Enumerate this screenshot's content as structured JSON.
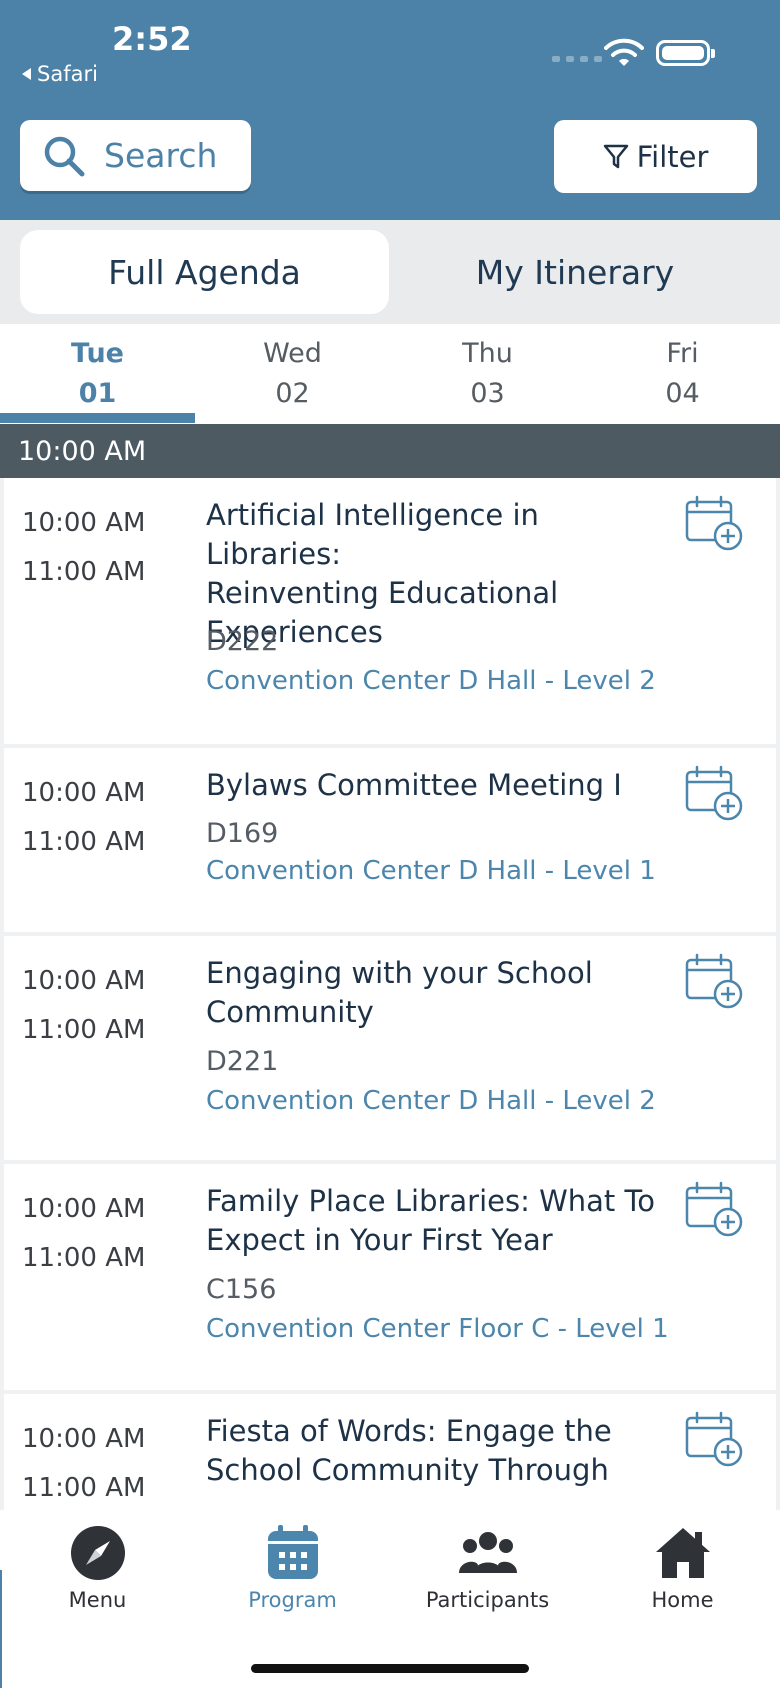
{
  "status_bar": {
    "time": "2:52",
    "back_app": "Safari"
  },
  "header": {
    "search_label": "Search",
    "filter_label": "Filter"
  },
  "segments": {
    "active": "Full Agenda",
    "other": "My Itinerary"
  },
  "days": [
    {
      "name": "Tue",
      "num": "01",
      "active": true
    },
    {
      "name": "Wed",
      "num": "02",
      "active": false
    },
    {
      "name": "Thu",
      "num": "03",
      "active": false
    },
    {
      "name": "Fri",
      "num": "04",
      "active": false
    }
  ],
  "time_group": "10:00 AM",
  "sessions": [
    {
      "start": "10:00 AM",
      "end": "11:00 AM",
      "title_lines": [
        "Artificial Intelligence in Libraries:",
        "Reinventing Educational",
        "Experiences"
      ],
      "room": "D222",
      "venue": "Convention Center D Hall - Level 2"
    },
    {
      "start": "10:00 AM",
      "end": "11:00 AM",
      "title_lines": [
        "Bylaws Committee Meeting I"
      ],
      "room": "D169",
      "venue": "Convention Center D Hall - Level 1"
    },
    {
      "start": "10:00 AM",
      "end": "11:00 AM",
      "title_lines": [
        "Engaging with your School",
        "Community"
      ],
      "room": "D221",
      "venue": "Convention Center D Hall - Level 2"
    },
    {
      "start": "10:00 AM",
      "end": "11:00 AM",
      "title_lines": [
        "Family Place Libraries: What To",
        "Expect in Your First Year"
      ],
      "room": "C156",
      "venue": "Convention Center Floor C - Level 1"
    },
    {
      "start": "10:00 AM",
      "end": "11:00 AM",
      "title_lines": [
        "Fiesta of Words: Engage the",
        "School Community Through"
      ],
      "room": "",
      "venue": ""
    }
  ],
  "tabbar": [
    {
      "label": "Menu",
      "icon": "compass-icon",
      "active": false
    },
    {
      "label": "Program",
      "icon": "calendar-icon",
      "active": true
    },
    {
      "label": "Participants",
      "icon": "people-icon",
      "active": false
    },
    {
      "label": "Home",
      "icon": "home-icon",
      "active": false
    }
  ],
  "colors": {
    "header": "#4c82a8",
    "accent": "#4c86ad",
    "time_header": "#4d5a62"
  }
}
